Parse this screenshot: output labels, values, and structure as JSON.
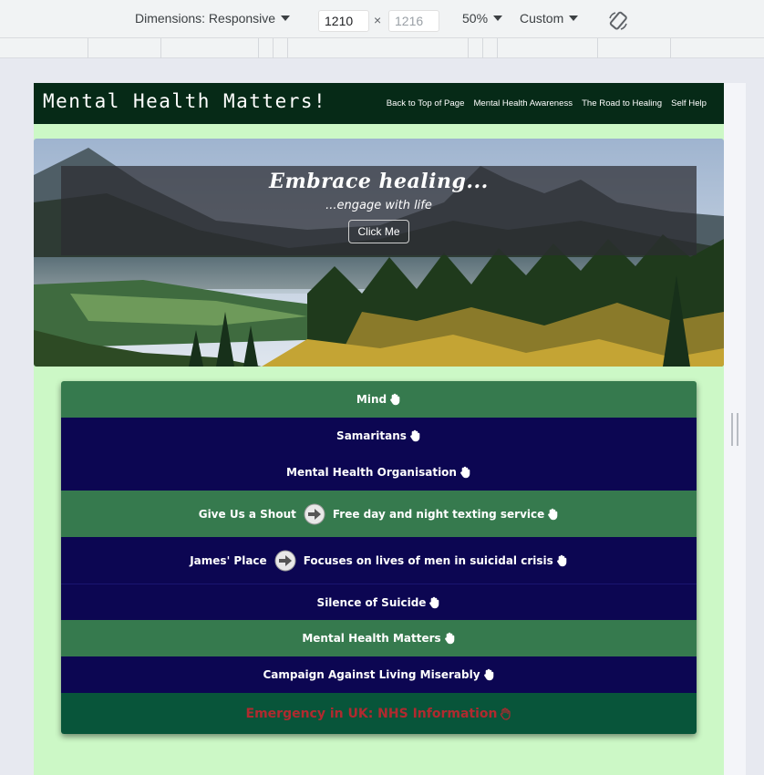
{
  "devtools": {
    "dimensions_label": "Dimensions: Responsive",
    "width_value": "1210",
    "height_placeholder": "1216",
    "times": "×",
    "zoom": "50%",
    "throttle": "Custom"
  },
  "site": {
    "title": "Mental Health Matters!",
    "nav": [
      {
        "label": "Back to Top of Page"
      },
      {
        "label": "Mental Health Awareness"
      },
      {
        "label": "The Road to Healing"
      },
      {
        "label": "Self Help"
      }
    ]
  },
  "hero": {
    "heading": "Embrace healing...",
    "subheading": "...engage with life",
    "button": "Click Me"
  },
  "links": [
    {
      "label": "Mind",
      "color": "#367a4e",
      "style": "green"
    },
    {
      "label": "Samaritans",
      "color": "#0c0652",
      "style": "navy"
    },
    {
      "label": "Mental Health Organisation",
      "color": "#0c0652",
      "style": "navy"
    },
    {
      "label": "Give Us a Shout",
      "detail": "Free day and night texting service",
      "color": "#367a4e",
      "style": "green"
    },
    {
      "label": "James' Place",
      "detail": "Focuses on lives of men in suicidal crisis",
      "color": "#0c0652",
      "style": "navy"
    },
    {
      "label": "Silence of Suicide",
      "color": "#0c0652",
      "style": "navy"
    },
    {
      "label": "Mental Health Matters",
      "color": "#367a4e",
      "style": "green"
    },
    {
      "label": "Campaign Against Living Miserably",
      "color": "#0c0652",
      "style": "navy"
    },
    {
      "label": "Emergency in UK: NHS Information",
      "color": "#08553a",
      "text_color": "#b02a2f",
      "style": "emergency"
    }
  ],
  "colors": {
    "page_bg": "#ccf8c6",
    "header_bg": "#062a17"
  }
}
